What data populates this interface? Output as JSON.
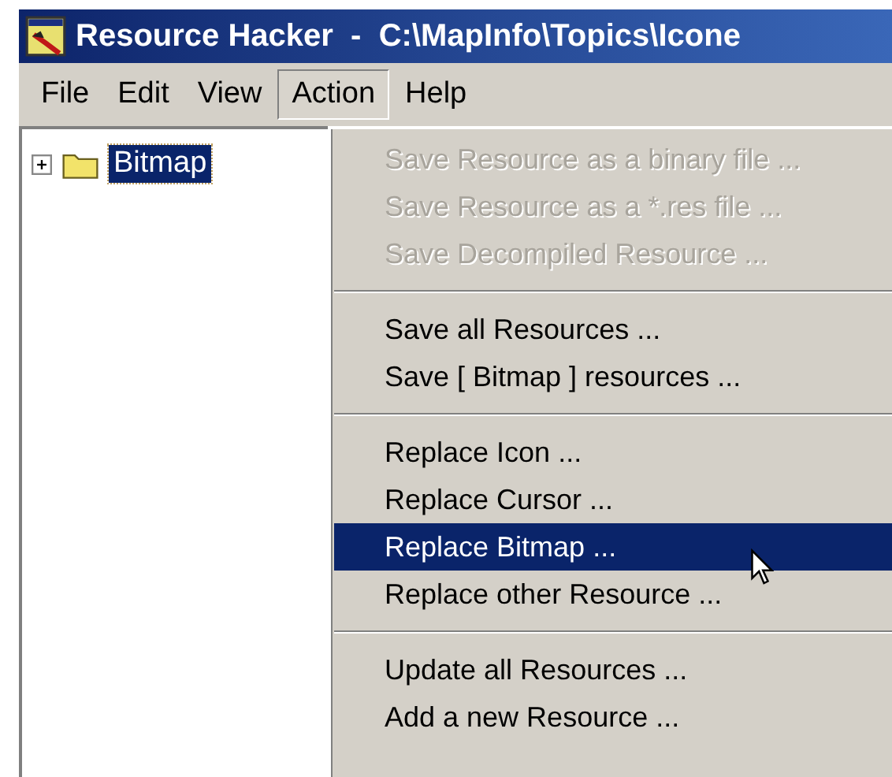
{
  "window": {
    "title": "Resource Hacker  -  C:\\MapInfo\\Topics\\Icone"
  },
  "menu_bar": [
    {
      "label": "File",
      "selected": false
    },
    {
      "label": "Edit",
      "selected": false
    },
    {
      "label": "View",
      "selected": false
    },
    {
      "label": "Action",
      "selected": true
    },
    {
      "label": "Help",
      "selected": false
    }
  ],
  "tree": [
    {
      "label": "Bitmap",
      "expanded": false,
      "selected": true
    }
  ],
  "action_menu": [
    {
      "kind": "item",
      "label": "Save Resource as a binary file ...",
      "disabled": true,
      "selected": false
    },
    {
      "kind": "item",
      "label": "Save Resource as a *.res file ...",
      "disabled": true,
      "selected": false
    },
    {
      "kind": "item",
      "label": "Save Decompiled Resource ...",
      "disabled": true,
      "selected": false
    },
    {
      "kind": "separator"
    },
    {
      "kind": "item",
      "label": "Save all Resources ...",
      "disabled": false,
      "selected": false
    },
    {
      "kind": "item",
      "label": "Save [ Bitmap ] resources ...",
      "disabled": false,
      "selected": false
    },
    {
      "kind": "separator"
    },
    {
      "kind": "item",
      "label": "Replace Icon ...",
      "disabled": false,
      "selected": false
    },
    {
      "kind": "item",
      "label": "Replace Cursor ...",
      "disabled": false,
      "selected": false
    },
    {
      "kind": "item",
      "label": "Replace Bitmap ...",
      "disabled": false,
      "selected": true
    },
    {
      "kind": "item",
      "label": "Replace other Resource ...",
      "disabled": false,
      "selected": false
    },
    {
      "kind": "separator"
    },
    {
      "kind": "item",
      "label": "Update all Resources ...",
      "disabled": false,
      "selected": false
    },
    {
      "kind": "item",
      "label": "Add a new Resource ...",
      "disabled": false,
      "selected": false
    }
  ]
}
